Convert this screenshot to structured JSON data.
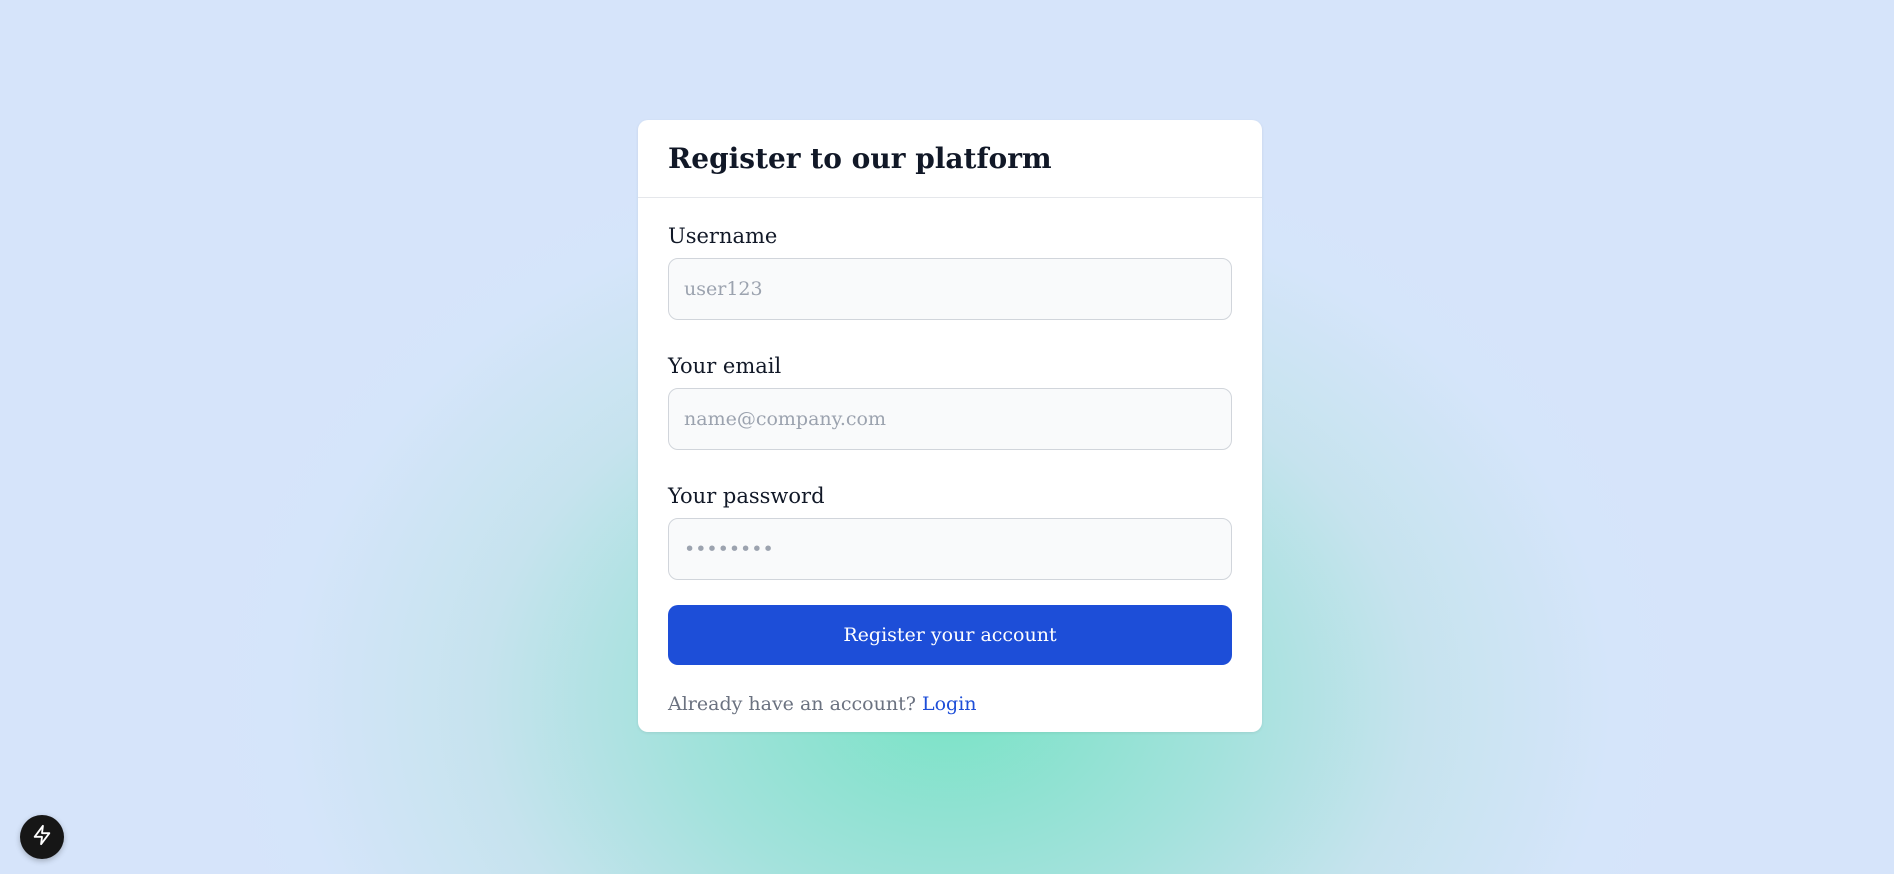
{
  "card": {
    "title": "Register to our platform"
  },
  "form": {
    "username": {
      "label": "Username",
      "placeholder": "user123",
      "value": ""
    },
    "email": {
      "label": "Your email",
      "placeholder": "name@company.com",
      "value": ""
    },
    "password": {
      "label": "Your password",
      "placeholder": "••••••••",
      "value": ""
    },
    "submit_label": "Register your account"
  },
  "footer": {
    "prompt": "Already have an account?",
    "login_label": "Login"
  },
  "icons": {
    "floating_button": "lightning-bolt-icon"
  },
  "colors": {
    "primary": "#1d4ed8",
    "input_background": "#f9fafb",
    "input_border": "#d1d5db",
    "title_text": "#111827",
    "muted_text": "#6b7280",
    "floating_button_bg": "#161616"
  }
}
